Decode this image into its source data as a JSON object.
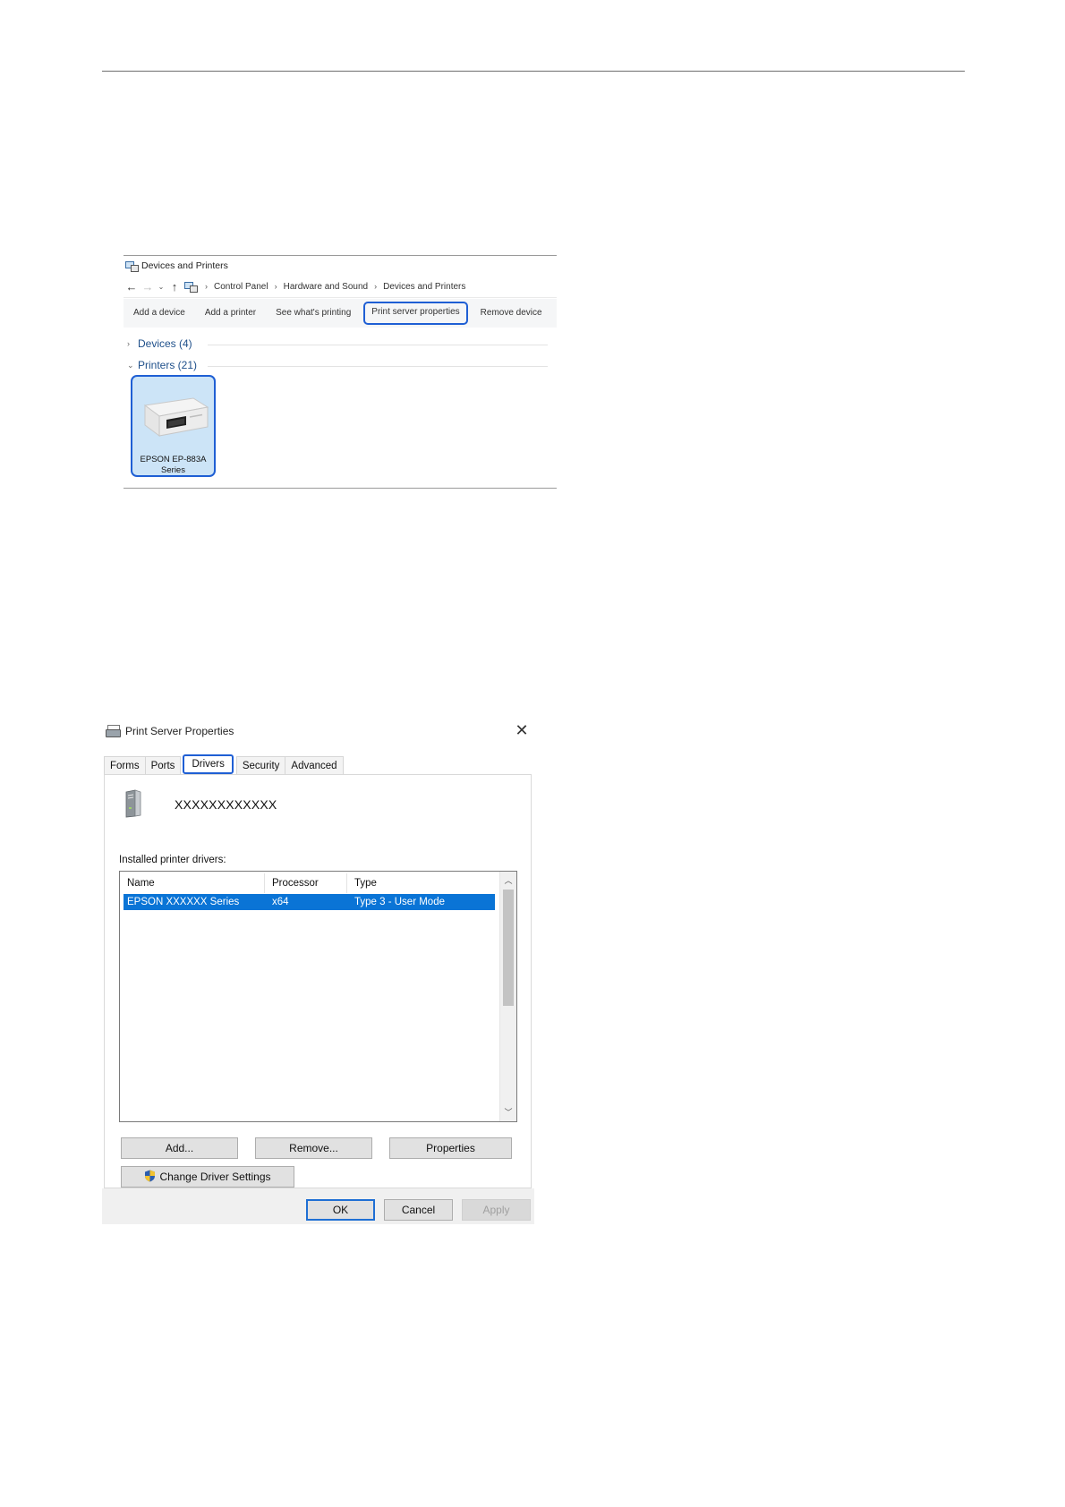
{
  "devices_window": {
    "title": "Devices and Printers",
    "breadcrumb": [
      "Control Panel",
      "Hardware and Sound",
      "Devices and Printers"
    ],
    "commands": [
      "Add a device",
      "Add a printer",
      "See what's printing",
      "Print server properties",
      "Remove device"
    ],
    "groups": {
      "devices": "Devices (4)",
      "printers": "Printers (21)"
    },
    "printer": {
      "name_line1": "EPSON EP-883A",
      "name_line2": "Series"
    },
    "highlight_color": "#1f5fd4"
  },
  "print_server": {
    "title": "Print Server Properties",
    "tabs": [
      "Forms",
      "Ports",
      "Drivers",
      "Security",
      "Advanced"
    ],
    "active_tab": "Drivers",
    "server_name": "XXXXXXXXXXXX",
    "installed_label": "Installed printer drivers:",
    "columns": [
      "Name",
      "Processor",
      "Type"
    ],
    "rows": [
      {
        "name": "EPSON XXXXXX Series",
        "processor": "x64",
        "type": "Type 3 - User Mode"
      }
    ],
    "buttons": {
      "add": "Add...",
      "remove": "Remove...",
      "properties": "Properties",
      "change_driver": "Change Driver Settings",
      "ok": "OK",
      "cancel": "Cancel",
      "apply": "Apply"
    },
    "selection_color": "#0a74d6"
  }
}
